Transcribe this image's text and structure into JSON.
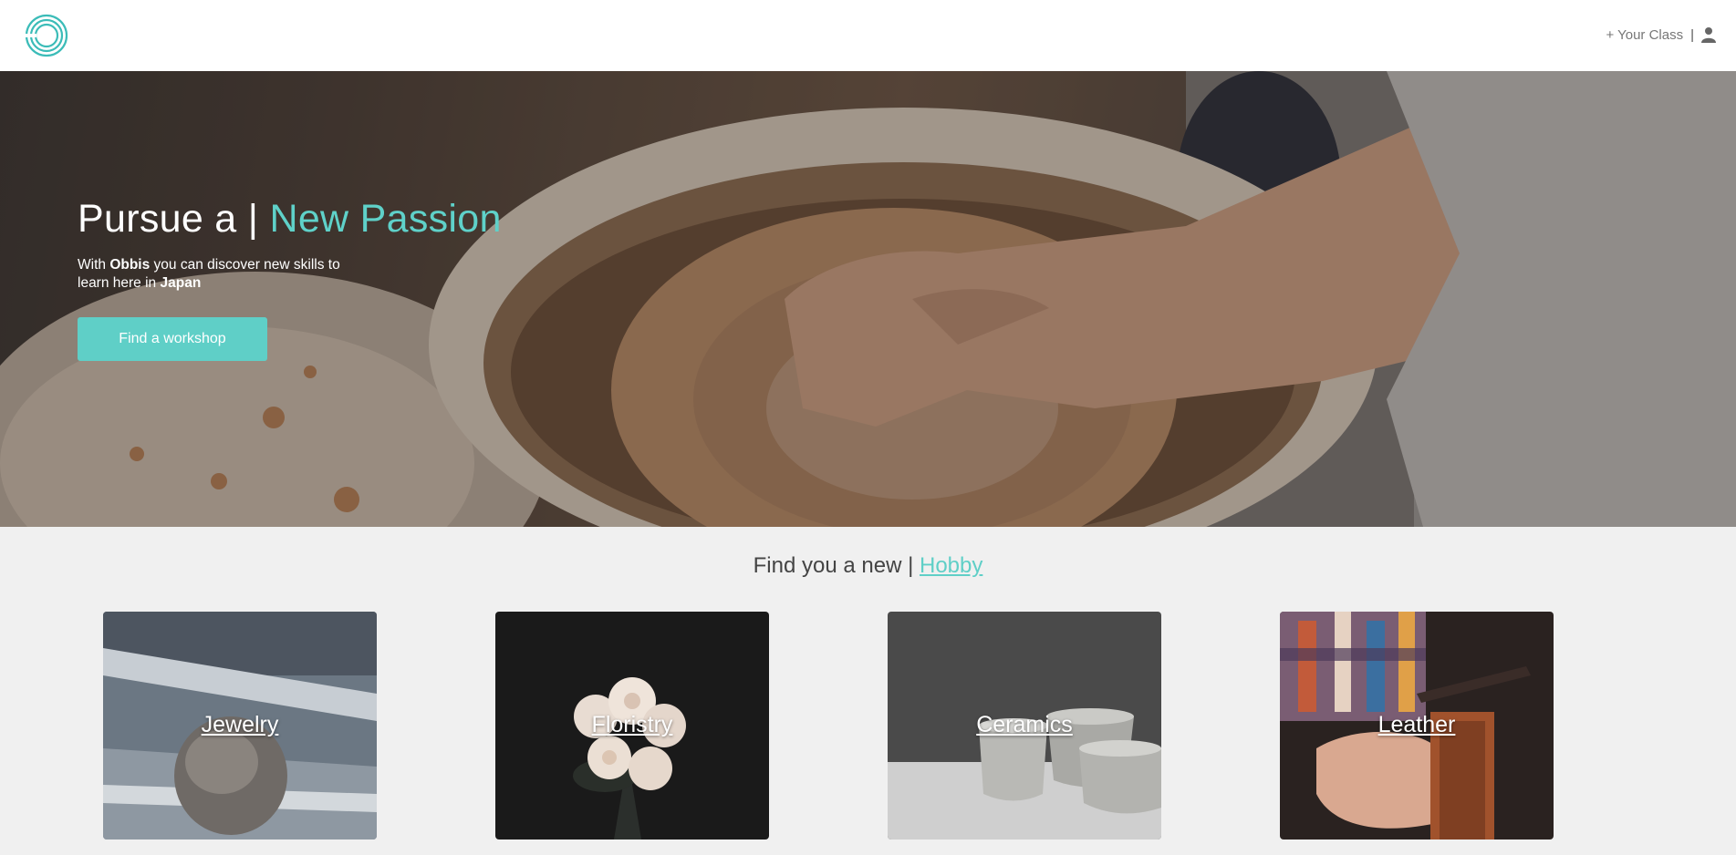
{
  "header": {
    "add_class_label": "+ Your Class",
    "separator": "|",
    "logo_icon": "rings-logo-icon",
    "user_icon": "user-icon"
  },
  "hero": {
    "title_prefix": "Pursue a | ",
    "title_accent": "New Passion",
    "sub_with": "With ",
    "sub_brand": "Obbis",
    "sub_mid": " you can discover new skills to learn here in ",
    "sub_place": "Japan",
    "cta_label": "Find a workshop"
  },
  "hobbies": {
    "title_prefix": "Find you a new | ",
    "title_accent": "Hobby",
    "cards": [
      {
        "label": "Jewelry"
      },
      {
        "label": "Floristry"
      },
      {
        "label": "Ceramics"
      },
      {
        "label": "Leather"
      }
    ]
  },
  "colors": {
    "accent": "#5fd1c9",
    "button": "#5fcfc7",
    "page_bg": "#f0f0f0"
  }
}
